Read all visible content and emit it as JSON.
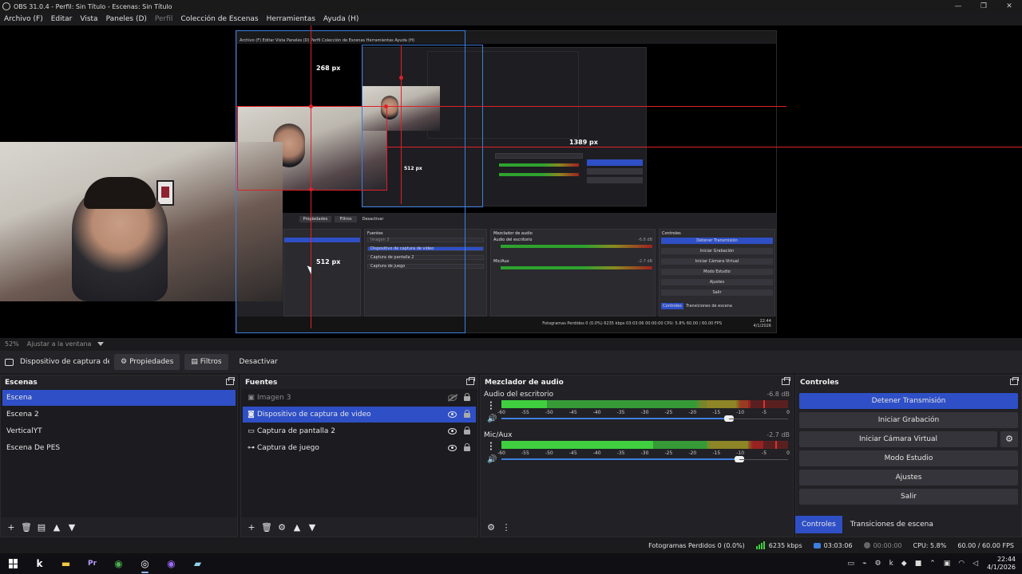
{
  "window": {
    "title": "OBS 31.0.4 - Perfil: Sin Título - Escenas: Sin Título",
    "minimize": "—",
    "maximize": "❐",
    "close": "✕"
  },
  "menu": {
    "items": [
      {
        "label": "Archivo (F)",
        "disabled": false
      },
      {
        "label": "Editar",
        "disabled": false
      },
      {
        "label": "Vista",
        "disabled": false
      },
      {
        "label": "Paneles (D)",
        "disabled": false
      },
      {
        "label": "Perfil",
        "disabled": true
      },
      {
        "label": "Colección de Escenas",
        "disabled": false
      },
      {
        "label": "Herramientas",
        "disabled": false
      },
      {
        "label": "Ayuda (H)",
        "disabled": false
      }
    ]
  },
  "preview": {
    "measure_top": "268 px",
    "measure_right": "1389 px",
    "measure_mid": "512 px",
    "measure_left": "512 px",
    "zoom": "52%",
    "fit_label": "Ajustar a la ventana",
    "nested": {
      "title": "OBS 31.0.4 - Perfil: Sin Título - Escenas: Sin Título",
      "menu": "Archivo (F)   Editar   Vista   Paneles (D)   Perfil   Colección de Escenas   Herramientas   Ayuda (H)",
      "toolbar_props": "Propiedades",
      "toolbar_filters": "Filtros",
      "toolbar_deactivate": "Desactivar",
      "sources_header": "Fuentes",
      "mixer_header": "Mezclador de audio",
      "controls_header": "Controles",
      "sources": [
        "Imagen 3",
        "Dispositivo de captura de video",
        "Captura de pantalla 2",
        "Captura de juego"
      ],
      "channel_1": "Audio del escritorio",
      "channel_2": "Mic/Aux",
      "db_1": "-6.8 dB",
      "db_2": "-2.7 dB",
      "controls": [
        "Detener Transmisión",
        "Iniciar Grabación",
        "Iniciar Cámara Virtual",
        "Modo Estudio",
        "Ajustes",
        "Salir"
      ],
      "tab_controls": "Controles",
      "tab_transitions": "Transiciones de escena",
      "status": "Fotogramas Perdidos 0 (0.0%)    6235 kbps    03:03:06    00:00:00    CPU: 5.8%    60.00 / 60.00 FPS",
      "time": "22:44",
      "date": "4/1/2026"
    }
  },
  "source_toolbar": {
    "source_name": "Dispositivo de captura de v",
    "properties": "Propiedades",
    "filters": "Filtros",
    "deactivate": "Desactivar"
  },
  "scenes": {
    "title": "Escenas",
    "items": [
      {
        "label": "Escena",
        "selected": true
      },
      {
        "label": "Escena 2",
        "selected": false
      },
      {
        "label": "VerticalYT",
        "selected": false
      },
      {
        "label": "Escena De PES",
        "selected": false
      }
    ]
  },
  "sources": {
    "title": "Fuentes",
    "items": [
      {
        "label": "Imagen 3",
        "icon": "image-icon",
        "visible": false,
        "selected": false
      },
      {
        "label": "Dispositivo de captura de video",
        "icon": "camera-icon",
        "visible": true,
        "selected": true
      },
      {
        "label": "Captura de pantalla 2",
        "icon": "monitor-icon",
        "visible": true,
        "selected": false
      },
      {
        "label": "Captura de juego",
        "icon": "gamepad-icon",
        "visible": true,
        "selected": false
      }
    ]
  },
  "mixer": {
    "title": "Mezclador de audio",
    "ticks": [
      "-60",
      "-55",
      "-50",
      "-45",
      "-40",
      "-35",
      "-30",
      "-25",
      "-20",
      "-15",
      "-10",
      "-5",
      "0"
    ],
    "channels": [
      {
        "name": "Audio del escritorio",
        "db": "-6.8 dB",
        "level_green": 0.16,
        "level_yellow": 0.87,
        "peak": 0.915,
        "volume": 0.83
      },
      {
        "name": "Mic/Aux",
        "db": "-2.7 dB",
        "level_green": 0.53,
        "level_yellow": 0.915,
        "peak": 0.955,
        "volume": 0.87
      }
    ]
  },
  "controls": {
    "title": "Controles",
    "stop_stream": "Detener Transmisión",
    "start_recording": "Iniciar Grabación",
    "start_virtual_cam": "Iniciar Cámara Virtual",
    "studio_mode": "Modo Estudio",
    "settings": "Ajustes",
    "exit": "Salir",
    "tab_controls": "Controles",
    "tab_transitions": "Transiciones de escena"
  },
  "status": {
    "dropped_frames": "Fotogramas Perdidos 0 (0.0%)",
    "bitrate": "6235 kbps",
    "stream_time": "03:03:06",
    "rec_time": "00:00:00",
    "cpu": "CPU: 5.8%",
    "fps": "60.00 / 60.00 FPS"
  },
  "taskbar": {
    "time": "22:44",
    "date": "4/1/2026"
  },
  "colors": {
    "accent": "#2f4fc6",
    "guide": "#e0202a",
    "selection": "#3d7fe0",
    "meter_green": "#3fcf3f"
  }
}
